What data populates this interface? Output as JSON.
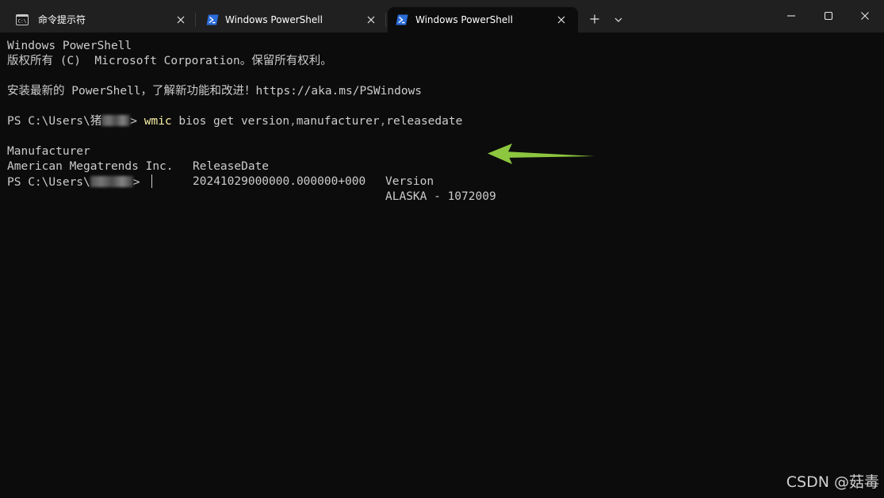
{
  "window": {
    "tabs": [
      {
        "label": "命令提示符",
        "icon": "cmd-icon",
        "active": false
      },
      {
        "label": "Windows PowerShell",
        "icon": "powershell-icon",
        "active": false
      },
      {
        "label": "Windows PowerShell",
        "icon": "powershell-icon",
        "active": true
      }
    ],
    "new_tab_symbol": "+",
    "dropdown_icon": "chevron-down-icon",
    "controls": [
      "minimize-icon",
      "maximize-icon",
      "close-icon"
    ]
  },
  "terminal": {
    "banner_line1": "Windows PowerShell",
    "banner_line2": "版权所有 (C)  Microsoft Corporation。保留所有权利。",
    "banner_line3": "安装最新的 PowerShell，了解新功能和改进！https://aka.ms/PSWindows",
    "prompt1_prefix": "PS C:\\Users\\猪",
    "prompt1_suffix": "> ",
    "command_exe": "wmic",
    "command_args": " bios get version",
    "command_sep1": ",",
    "command_arg2": "manufacturer",
    "command_sep2": ",",
    "command_arg3": "releasedate",
    "table_headers": [
      "Manufacturer",
      "ReleaseDate",
      "Version"
    ],
    "table_row": [
      "American Megatrends Inc.",
      "20241029000000.000000+000",
      "ALASKA - 1072009"
    ],
    "prompt2_prefix": "PS C:\\Users\\",
    "prompt2_suffix": "> "
  },
  "annotation": {
    "arrow_color": "#8dc63f"
  },
  "watermark": "CSDN @菇毒"
}
